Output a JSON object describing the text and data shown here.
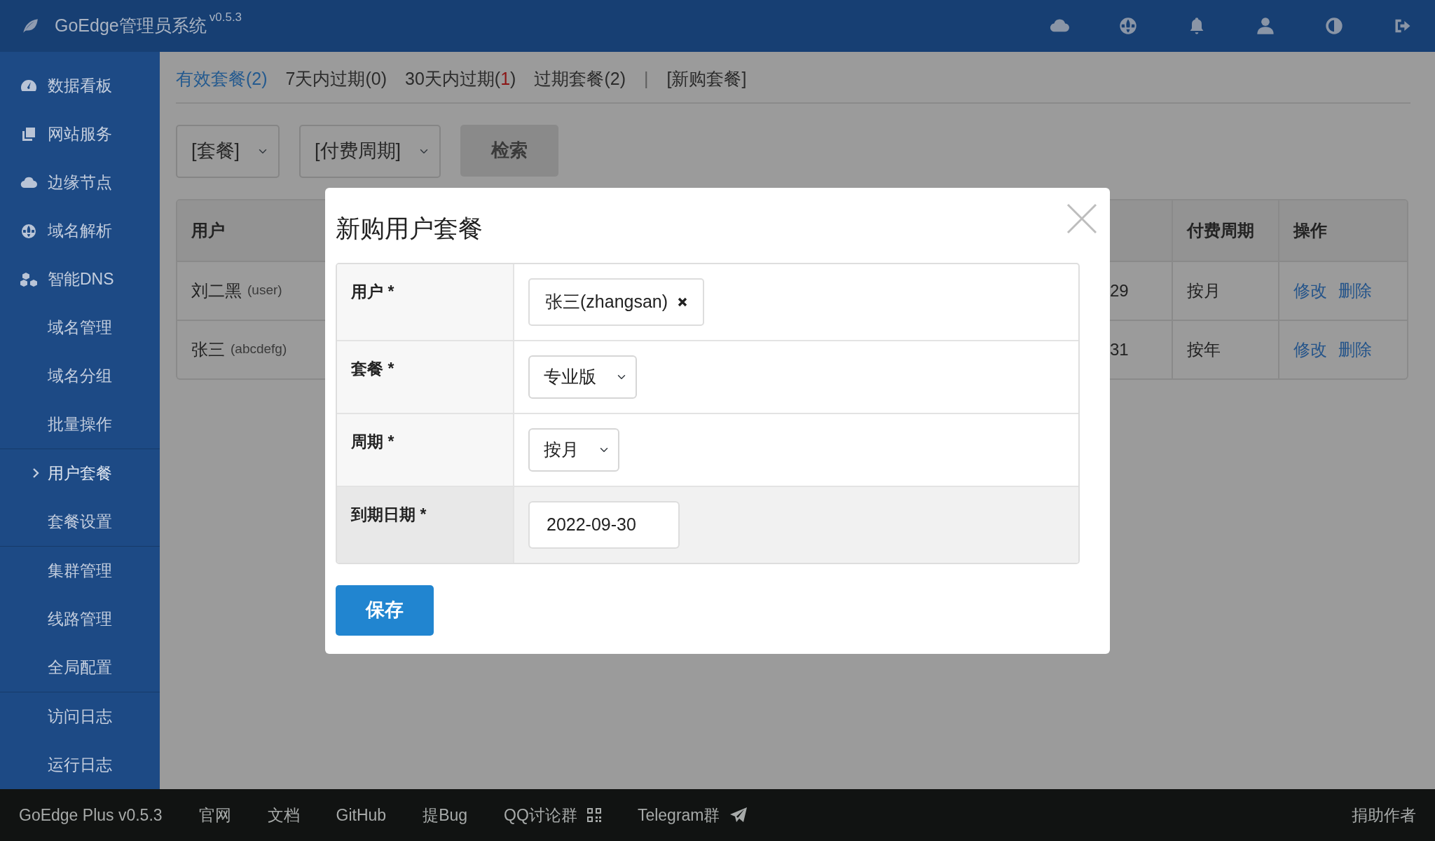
{
  "top_bar": {
    "title": "GoEdge管理员系统",
    "version": "v0.5.3"
  },
  "sidebar": {
    "items": [
      {
        "kind": "main",
        "label": "数据看板",
        "selected": false
      },
      {
        "kind": "main",
        "label": "网站服务",
        "selected": false
      },
      {
        "kind": "main",
        "label": "边缘节点",
        "selected": false
      },
      {
        "kind": "main",
        "label": "域名解析",
        "selected": false
      },
      {
        "kind": "main",
        "label": "智能DNS",
        "selected": false
      },
      {
        "kind": "sub",
        "label": "域名管理",
        "selected": false
      },
      {
        "kind": "sub",
        "label": "域名分组",
        "selected": false
      },
      {
        "kind": "sub",
        "label": "批量操作",
        "selected": false
      },
      {
        "kind": "divider"
      },
      {
        "kind": "sub",
        "label": "用户套餐",
        "selected": true
      },
      {
        "kind": "sub",
        "label": "套餐设置",
        "selected": false
      },
      {
        "kind": "divider"
      },
      {
        "kind": "sub",
        "label": "集群管理",
        "selected": false
      },
      {
        "kind": "sub",
        "label": "线路管理",
        "selected": false
      },
      {
        "kind": "sub",
        "label": "全局配置",
        "selected": false
      },
      {
        "kind": "divider"
      },
      {
        "kind": "sub",
        "label": "访问日志",
        "selected": false
      },
      {
        "kind": "sub",
        "label": "运行日志",
        "selected": false
      }
    ]
  },
  "tabs": [
    {
      "kind": "tab",
      "parts": [
        "有效套餐(",
        "2",
        ")"
      ],
      "alert": false,
      "selected": true
    },
    {
      "kind": "tab",
      "parts": [
        "7天内过期(",
        "0",
        ")"
      ],
      "alert": false,
      "selected": false
    },
    {
      "kind": "tab",
      "parts": [
        "30天内过期(",
        "1",
        ")"
      ],
      "alert": true,
      "selected": false
    },
    {
      "kind": "tab",
      "parts": [
        "过期套餐(",
        "2",
        ")"
      ],
      "alert": false,
      "selected": false
    },
    {
      "kind": "separator",
      "text": "|"
    },
    {
      "kind": "tab",
      "parts": [
        "[新购套餐]"
      ],
      "alert": false,
      "selected": false
    }
  ],
  "filters": {
    "plan_select": "[套餐]",
    "period_select": "[付费周期]",
    "search_button": "检索"
  },
  "table": {
    "columns": [
      "用户",
      "",
      "",
      "付费周期",
      "操作"
    ],
    "rows": [
      {
        "user": "刘二黑",
        "username": "(user)",
        "column_3": "29",
        "period": "按月",
        "actions": [
          "修改",
          "删除"
        ]
      },
      {
        "user": "张三",
        "username": "(abcdefg)",
        "column_3": "31",
        "period": "按年",
        "actions": [
          "修改",
          "删除"
        ]
      }
    ]
  },
  "modal": {
    "title": "新购用户套餐",
    "fields": [
      {
        "kind": "user",
        "label": "用户 *",
        "value": "张三(zhangsan)",
        "highlighted": false
      },
      {
        "kind": "select",
        "label": "套餐 *",
        "value": "专业版",
        "highlighted": false
      },
      {
        "kind": "select",
        "label": "周期 *",
        "value": "按月",
        "highlighted": false
      },
      {
        "kind": "date",
        "label": "到期日期 *",
        "value": "2022-09-30",
        "highlighted": true
      }
    ],
    "save_button": "保存"
  },
  "footer": {
    "links": [
      {
        "kind": "plain",
        "label": "GoEdge Plus v0.5.3"
      },
      {
        "kind": "plain",
        "label": "官网"
      },
      {
        "kind": "plain",
        "label": "文档"
      },
      {
        "kind": "plain",
        "label": "GitHub"
      },
      {
        "kind": "plain",
        "label": "提Bug"
      },
      {
        "kind": "qr",
        "label": "QQ讨论群"
      },
      {
        "kind": "telegram",
        "label": "Telegram群"
      }
    ],
    "right_link": "捐助作者"
  }
}
